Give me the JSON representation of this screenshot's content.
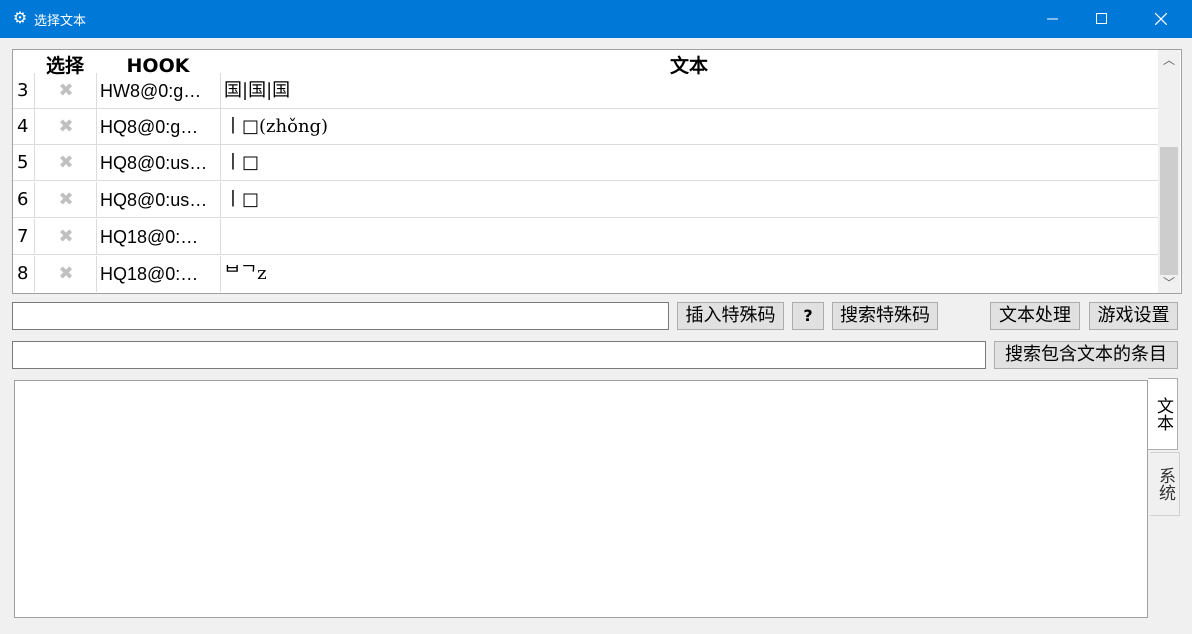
{
  "window": {
    "title": "选择文本",
    "icon": "gear-icon",
    "accent_color": "#0078d7"
  },
  "table": {
    "headers": {
      "index": "",
      "select": "选择",
      "hook": "HOOK",
      "text": "文本"
    },
    "rows": [
      {
        "index": "3",
        "select": "✖",
        "hook": "HW8@0:g…",
        "text": "国|国|国"
      },
      {
        "index": "4",
        "select": "✖",
        "hook": "HQ8@0:g…",
        "text": "⼁□(zhǒng)"
      },
      {
        "index": "5",
        "select": "✖",
        "hook": "HQ8@0:us…",
        "text": "⼁□"
      },
      {
        "index": "6",
        "select": "✖",
        "hook": "HQ8@0:us…",
        "text": "⼁□"
      },
      {
        "index": "7",
        "select": "✖",
        "hook": "HQ18@0:…",
        "text": ""
      },
      {
        "index": "8",
        "select": "✖",
        "hook": "HQ18@0:…",
        "text": "ᄇᄀᴢ"
      }
    ]
  },
  "controls": {
    "special_code_input_value": "",
    "insert_special_code": "插入特殊码",
    "help": "?",
    "search_special_code": "搜索特殊码",
    "text_processing": "文本处理",
    "game_settings": "游戏设置",
    "search_text_input_value": "",
    "search_entries_with_text": "搜索包含文本的条目"
  },
  "tabs": {
    "text": "文本",
    "system": "系统"
  }
}
